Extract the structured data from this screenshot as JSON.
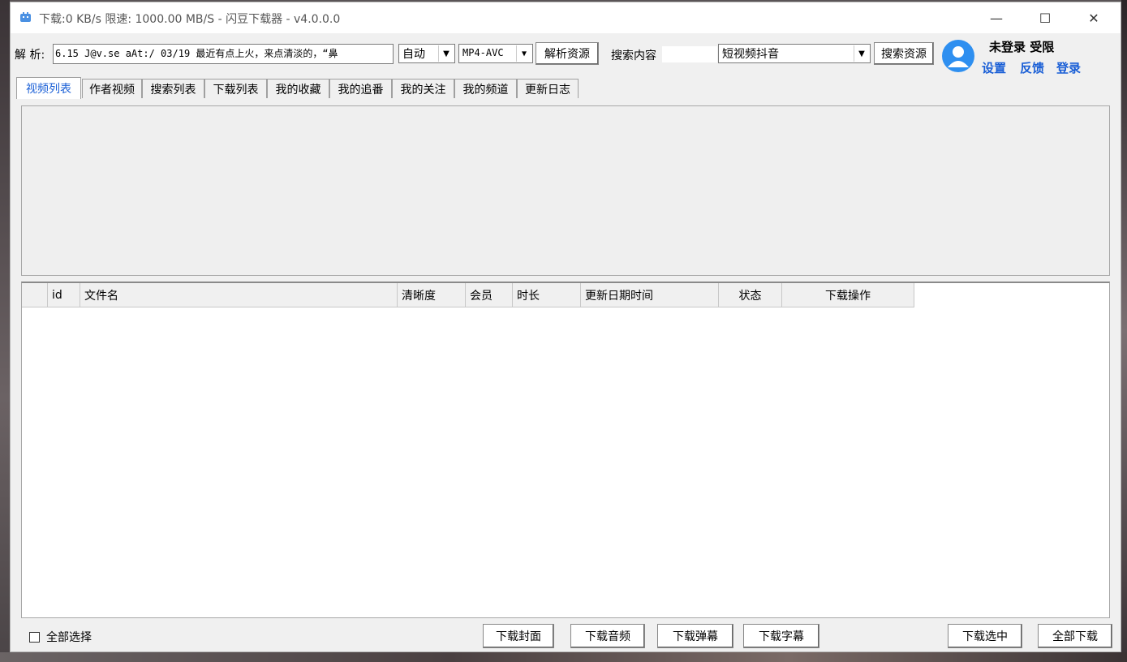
{
  "window": {
    "title": "下载:0 KB/s  限速: 1000.00 MB/S  - 闪豆下载器 - v4.0.0.0",
    "minimize": "—",
    "maximize": "☐",
    "close": "✕"
  },
  "parse": {
    "label": "解 析:",
    "url_value": "6.15 J@v.se aAt:/ 03/19 最近有点上火，来点清淡的，“鼻",
    "quality": "自动",
    "format": "MP4-AVC",
    "parse_button": "解析资源"
  },
  "search": {
    "label": "搜索内容",
    "query": "",
    "source": "短视频抖音",
    "search_button": "搜索资源"
  },
  "user": {
    "status": "未登录 受限",
    "settings": "设置",
    "feedback": "反馈",
    "login": "登录"
  },
  "tabs": [
    "视频列表",
    "作者视频",
    "搜索列表",
    "下载列表",
    "我的收藏",
    "我的追番",
    "我的关注",
    "我的频道",
    "更新日志"
  ],
  "active_tab": 0,
  "table": {
    "columns": [
      "",
      "id",
      "文件名",
      "清晰度",
      "会员",
      "时长",
      "更新日期时间",
      "状态",
      "下载操作"
    ],
    "rows": []
  },
  "footer": {
    "select_all": "全部选择",
    "download_cover": "下载封面",
    "download_audio": "下载音频",
    "download_danmaku": "下载弹幕",
    "download_subtitle": "下载字幕",
    "download_selected": "下载选中",
    "download_all": "全部下载"
  },
  "colors": {
    "accent": "#1a5fd6",
    "avatar": "#2e8ff0"
  }
}
